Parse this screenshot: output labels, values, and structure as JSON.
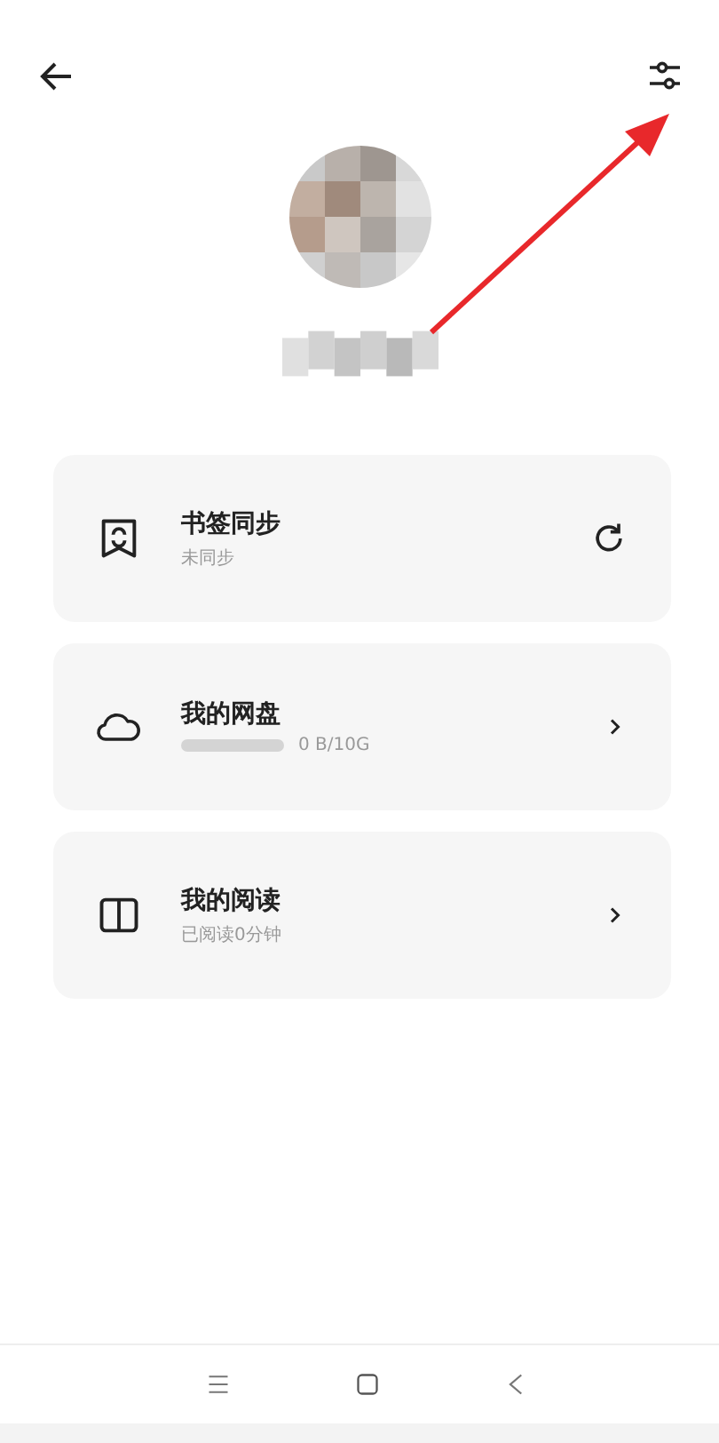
{
  "cards": [
    {
      "kind": "sync",
      "title": "书签同步",
      "subtitle": "未同步"
    },
    {
      "kind": "storage",
      "title": "我的网盘",
      "subtitle": "0 B/10G",
      "level": 0
    },
    {
      "kind": "reading",
      "title": "我的阅读",
      "subtitle": "已阅读0分钟"
    }
  ]
}
